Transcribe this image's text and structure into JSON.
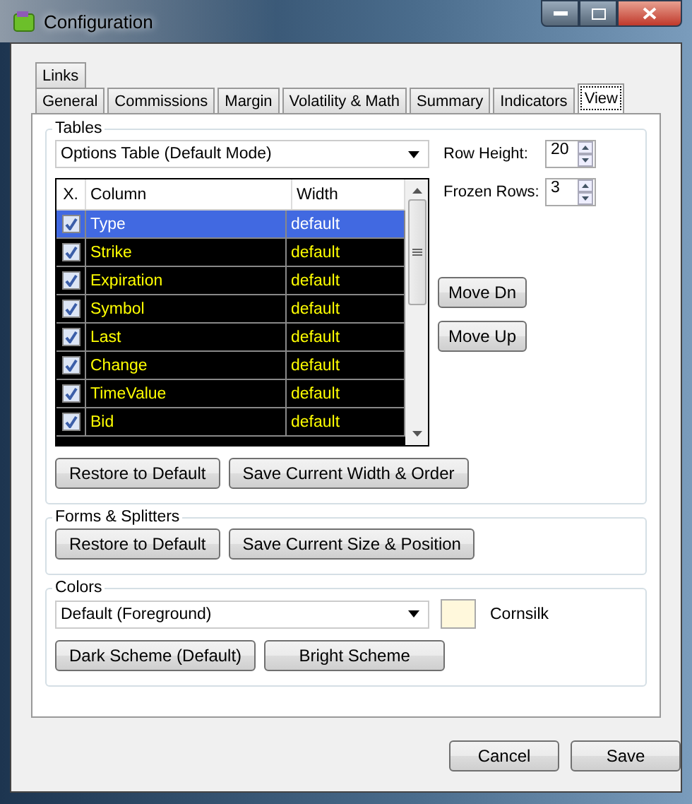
{
  "window": {
    "title": "Configuration"
  },
  "tab_rows": [
    [
      {
        "label": "Links",
        "selected": false
      }
    ],
    [
      {
        "label": "General",
        "selected": false
      },
      {
        "label": "Commissions",
        "selected": false
      },
      {
        "label": "Margin",
        "selected": false
      },
      {
        "label": "Volatility & Math",
        "selected": false
      },
      {
        "label": "Summary",
        "selected": false
      },
      {
        "label": "Indicators",
        "selected": false
      },
      {
        "label": "View",
        "selected": true
      }
    ]
  ],
  "tables": {
    "title": "Tables",
    "dropdown": "Options Table (Default Mode)",
    "grid": {
      "columns": [
        "X.",
        "Column",
        "Width"
      ],
      "rows": [
        {
          "checked": true,
          "name": "Type",
          "width": "default",
          "selected": true
        },
        {
          "checked": true,
          "name": "Strike",
          "width": "default",
          "selected": false
        },
        {
          "checked": true,
          "name": "Expiration",
          "width": "default",
          "selected": false
        },
        {
          "checked": true,
          "name": "Symbol",
          "width": "default",
          "selected": false
        },
        {
          "checked": true,
          "name": "Last",
          "width": "default",
          "selected": false
        },
        {
          "checked": true,
          "name": "Change",
          "width": "default",
          "selected": false
        },
        {
          "checked": true,
          "name": "TimeValue",
          "width": "default",
          "selected": false
        },
        {
          "checked": true,
          "name": "Bid",
          "width": "default",
          "selected": false
        }
      ]
    },
    "row_height": {
      "label": "Row Height:",
      "value": "20"
    },
    "frozen_rows": {
      "label": "Frozen Rows:",
      "value": "3"
    },
    "move_buttons": [
      "Move Dn",
      "Move Up"
    ],
    "buttons": [
      "Restore to Default",
      "Save Current Width & Order"
    ]
  },
  "forms": {
    "title": "Forms & Splitters",
    "buttons": [
      "Restore to Default",
      "Save Current Size & Position"
    ]
  },
  "colors": {
    "title": "Colors",
    "dropdown": "Default (Foreground)",
    "swatch": {
      "color": "#fff8dc",
      "name": "Cornsilk"
    },
    "buttons": [
      "Dark Scheme (Default)",
      "Bright Scheme"
    ]
  },
  "footer": [
    "Cancel",
    "Save"
  ]
}
